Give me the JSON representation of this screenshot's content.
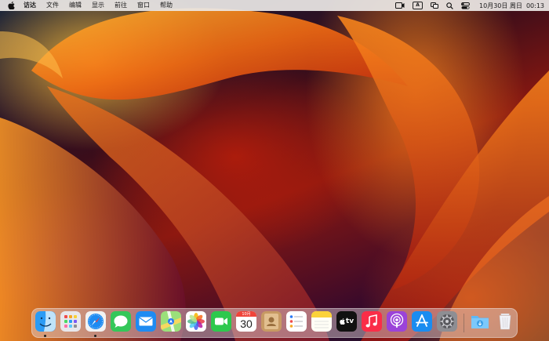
{
  "menubar": {
    "apple_icon": "apple-logo-icon",
    "app_name": "访达",
    "menus": [
      "文件",
      "编辑",
      "显示",
      "前往",
      "窗口",
      "帮助"
    ],
    "status_icons": [
      "screen-record-icon",
      "input-method-icon",
      "screen-mirroring-icon",
      "spotlight-search-icon",
      "control-center-icon"
    ],
    "input_method_label": "A",
    "date": "10月30日 周日",
    "time": "00:13"
  },
  "dock": {
    "apps": [
      {
        "name": "Finder",
        "icon": "finder-icon",
        "running": true
      },
      {
        "name": "Launchpad",
        "icon": "launchpad-icon",
        "running": false
      },
      {
        "name": "Safari",
        "icon": "safari-icon",
        "running": true
      },
      {
        "name": "Messages",
        "icon": "messages-icon",
        "running": false
      },
      {
        "name": "Mail",
        "icon": "mail-icon",
        "running": false
      },
      {
        "name": "Maps",
        "icon": "maps-icon",
        "running": false
      },
      {
        "name": "Photos",
        "icon": "photos-icon",
        "running": false
      },
      {
        "name": "FaceTime",
        "icon": "facetime-icon",
        "running": false
      },
      {
        "name": "Calendar",
        "icon": "calendar-icon",
        "running": false
      },
      {
        "name": "Contacts",
        "icon": "contacts-icon",
        "running": false
      },
      {
        "name": "Reminders",
        "icon": "reminders-icon",
        "running": false
      },
      {
        "name": "Notes",
        "icon": "notes-icon",
        "running": false
      },
      {
        "name": "TV",
        "icon": "apple-tv-icon",
        "running": false
      },
      {
        "name": "Music",
        "icon": "music-icon",
        "running": false
      },
      {
        "name": "Podcasts",
        "icon": "podcasts-icon",
        "running": false
      },
      {
        "name": "App Store",
        "icon": "app-store-icon",
        "running": false
      },
      {
        "name": "System Settings",
        "icon": "system-settings-icon",
        "running": false
      }
    ],
    "calendar_month": "10月",
    "calendar_day": "30",
    "tv_label": "tv",
    "downloads_icon": "downloads-folder-icon",
    "trash_icon": "trash-icon"
  },
  "colors": {
    "menubar_bg": "#ECE8E6",
    "messages_green": "#34C759",
    "mail_blue": "#1E8BF2",
    "facetime_green": "#2DC84D",
    "music_red": "#FA2D48",
    "podcasts_purple": "#9B43D9",
    "appstore_blue": "#1A8CF0",
    "tv_black": "#111111"
  }
}
